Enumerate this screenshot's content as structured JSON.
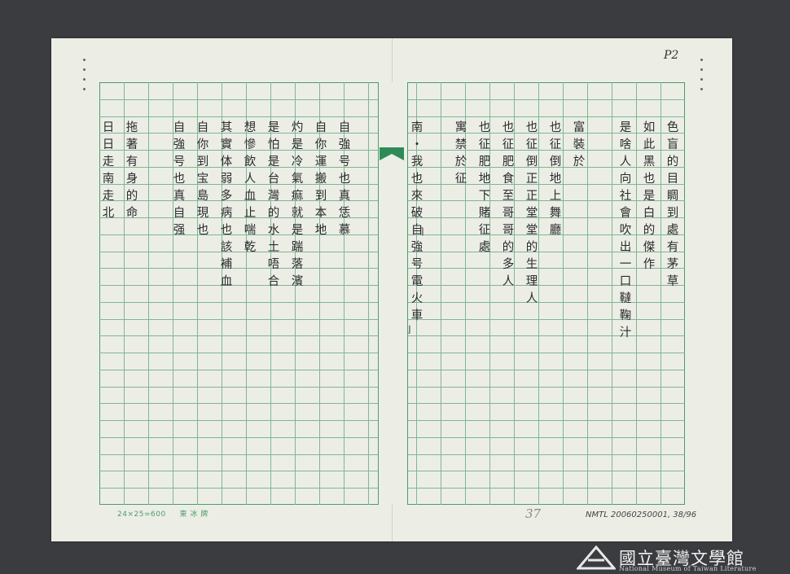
{
  "page_number": "P2",
  "columns": [
    "色盲的目睭到處有茅草",
    "如此黑也是白的傑作",
    "是啥人向社會吹出一口韃鞠汁",
    "",
    "富裝於",
    "也征倒地上舞廳",
    "也征倒正正堂堂的生理人",
    "也征肥食至哥哥的多人",
    "也征肥地下賭征處",
    "寓禁於征",
    "",
    "",
    "南・我也來破自強号電火車",
    "自強号也真恁慕",
    "自你運搬到本地",
    "灼是冷氣痲就是踹落濱",
    "是怕是台灣的水土唔合",
    "想慘飲人血止喘乾",
    "其實体弱多病也該補血",
    "自你到宝島現也",
    "自強号也真自强",
    "",
    "拖著有身的命",
    "日日走南走北"
  ],
  "footer": {
    "grid_spec": "24×25=600",
    "publisher": "東 冰 牌",
    "sheet_number": "37",
    "archive_id": "NMTL 20060250001, 38/96"
  },
  "logo": {
    "name_zh": "國立臺灣文學館",
    "name_en": "National Museum of Taiwan Literature"
  }
}
